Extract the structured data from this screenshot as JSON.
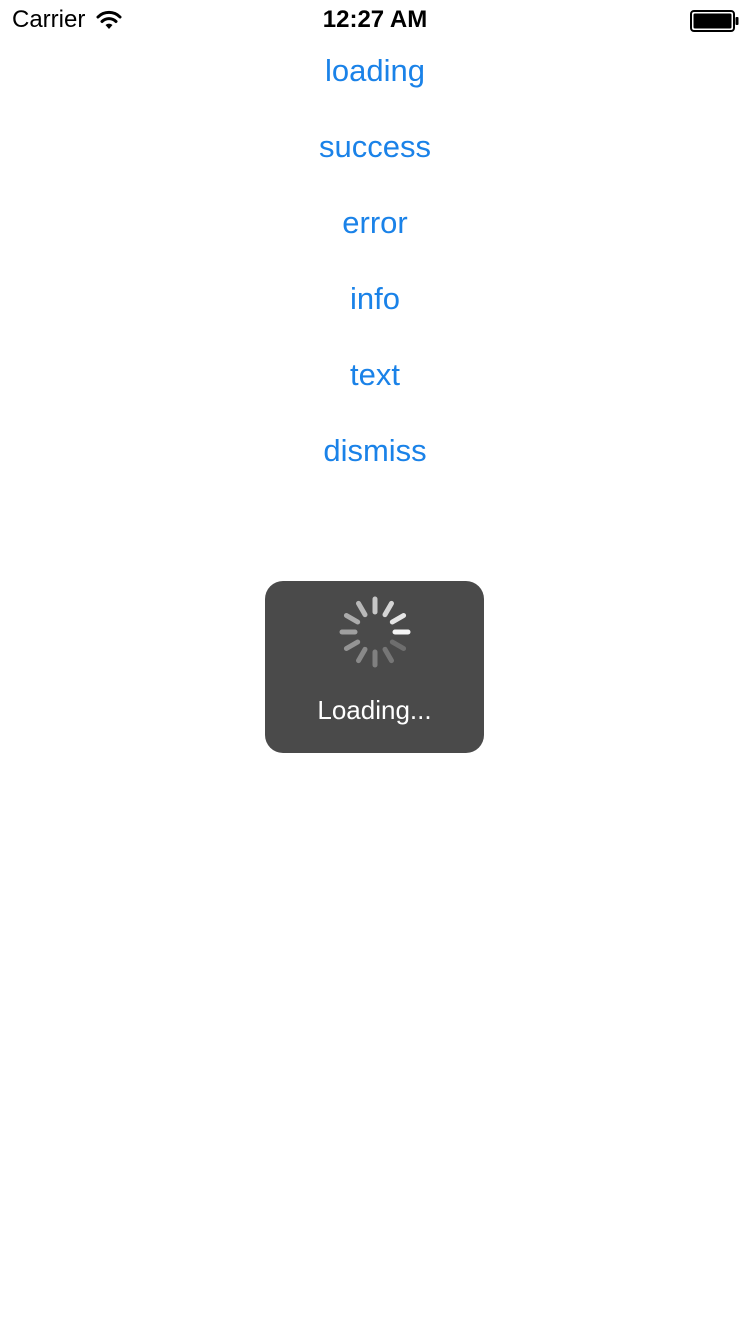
{
  "status_bar": {
    "carrier": "Carrier",
    "time": "12:27 AM",
    "wifi_icon": "wifi-icon",
    "battery_icon": "battery-full-icon"
  },
  "buttons": [
    {
      "label": "loading"
    },
    {
      "label": "success"
    },
    {
      "label": "error"
    },
    {
      "label": "info"
    },
    {
      "label": "text"
    },
    {
      "label": "dismiss"
    }
  ],
  "hud": {
    "icon": "spinner-icon",
    "label": "Loading..."
  },
  "colors": {
    "accent": "#1a82e8",
    "hud_background": "#4a4a4a",
    "hud_text": "#ffffff"
  }
}
